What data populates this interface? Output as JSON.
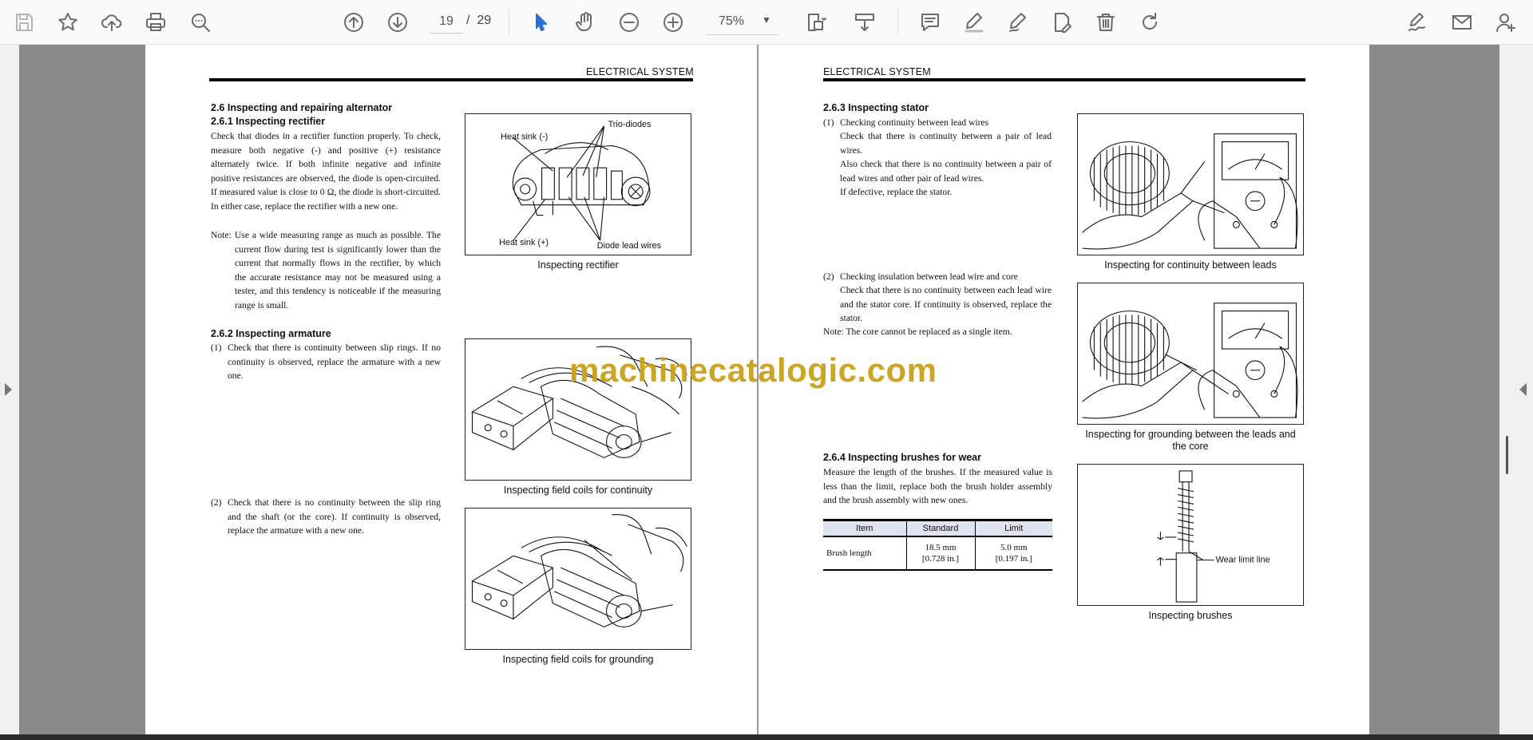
{
  "toolbar": {
    "page_current": "19",
    "page_separator": "/",
    "page_total": "29",
    "zoom": "75%",
    "buttons": [
      "save",
      "bookmark",
      "upload",
      "print",
      "find",
      "prev-page",
      "next-page",
      "select-tool",
      "hand-tool",
      "zoom-out",
      "zoom-in",
      "page-display",
      "scroll-mode",
      "comment",
      "highlight",
      "draw",
      "edit-pdf",
      "delete",
      "rotate",
      "sign",
      "email",
      "add-user"
    ]
  },
  "left_page": {
    "header": "ELECTRICAL SYSTEM",
    "section_2_6": "2.6   Inspecting and repairing alternator",
    "section_2_6_1": "2.6.1    Inspecting rectifier",
    "rectifier_text": "Check that diodes in a rectifier function properly. To check, measure both negative (-) and positive (+) resistance alternately twice. If both infinite negative and infinite positive resistances are observed, the diode is open-circuited. If measured value is close to 0 Ω, the diode is short-circuited.  In either case, replace the rectifier with a new one.",
    "note_label": "Note:",
    "note_text": "Use a wide measuring range as much as possible. The current flow during test is significantly lower than the current that normally flows in the rectifier, by which the accurate resistance may not be measured using a tester, and this tendency is noticeable if the measuring range is small.",
    "fig_rectifier_labels": {
      "heat_sink_neg": "Heat sink (-)",
      "trio_diodes": "Trio-diodes",
      "heat_sink_pos": "Heat sink (+)",
      "diode_lead_wires": "Diode lead wires"
    },
    "caption_rectifier": "Inspecting rectifier",
    "section_2_6_2": "2.6.2    Inspecting armature",
    "armature_1_num": "(1)",
    "armature_1_text": "Check that there is continuity between slip rings. If no continuity is observed, replace the armature with a new one.",
    "caption_field_continuity": "Inspecting field coils for continuity",
    "armature_2_num": "(2)",
    "armature_2_text": "Check that there is no continuity between the slip ring and the shaft (or the core). If continuity is observed, replace the armature with a new one.",
    "caption_field_grounding": "Inspecting field coils for grounding"
  },
  "right_page": {
    "header": "ELECTRICAL SYSTEM",
    "section_2_6_3": "2.6.3    Inspecting stator",
    "stator_1_num": "(1)",
    "stator_1_title": "Checking continuity between lead wires",
    "stator_1_text_a": "Check that there is continuity between a pair of lead wires.",
    "stator_1_text_b": "Also check that there is no continuity between a pair of lead wires and other pair of lead wires.",
    "stator_1_text_c": "If defective, replace the stator.",
    "caption_leads": "Inspecting for continuity between leads",
    "stator_2_num": "(2)",
    "stator_2_title": "Checking insulation between lead wire and core",
    "stator_2_text": "Check that there is no continuity between each lead wire and the stator core. If continuity is observed, replace the stator.",
    "stator_note": "Note: The core cannot be replaced as a single item.",
    "caption_grounding": "Inspecting for grounding between the leads and the core",
    "section_2_6_4": "2.6.4    Inspecting brushes for wear",
    "brush_text": "Measure the length of the brushes. If the measured value is less than the limit, replace both the brush holder assembly and the brush assembly with new ones.",
    "table": {
      "headers": [
        "Item",
        "Standard",
        "Limit"
      ],
      "row_item": "Brush length",
      "row_standard_1": "18.5 mm",
      "row_standard_2": "[0.728 in.]",
      "row_limit_1": "5.0 mm",
      "row_limit_2": "[0.197 in.]"
    },
    "fig_brush_label": "Wear limit line",
    "caption_brushes": "Inspecting brushes"
  },
  "watermark": "machinecatalogic.com"
}
